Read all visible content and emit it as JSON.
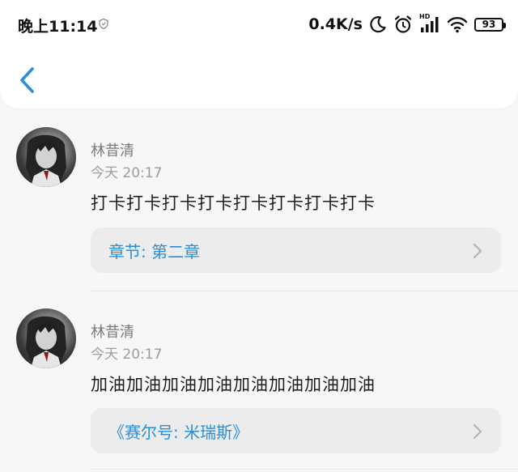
{
  "status_bar": {
    "time": "晚上11:14",
    "net_speed": "0.4K/s",
    "signal_label": "HD",
    "battery": "93"
  },
  "comments": [
    {
      "author": "林昔清",
      "time": "今天 20:17",
      "content": "打卡打卡打卡打卡打卡打卡打卡打卡",
      "link": "章节: 第二章"
    },
    {
      "author": "林昔清",
      "time": "今天 20:17",
      "content": "加油加油加油加油加油加油加油加油",
      "link": "《赛尔号: 米瑞斯》"
    }
  ],
  "colors": {
    "accent": "#2a8ed8",
    "background": "#f7f7f7",
    "card": "#ececec"
  }
}
